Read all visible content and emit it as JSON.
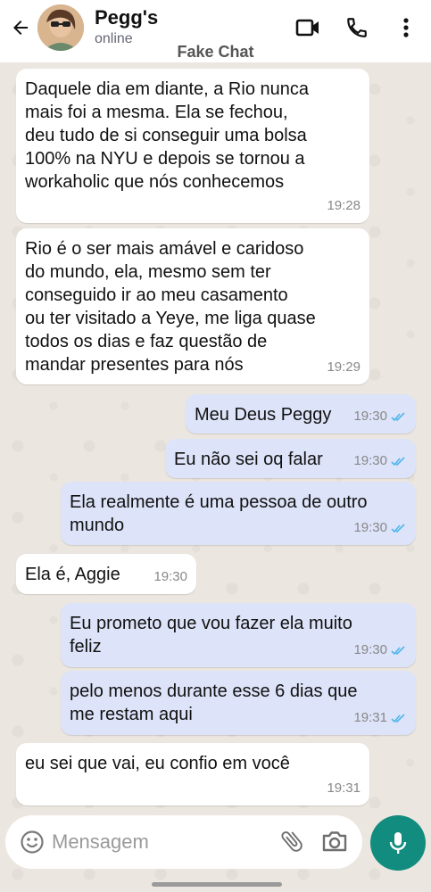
{
  "header": {
    "contact_name": "Pegg's",
    "status": "online",
    "watermark": "Fake Chat",
    "icons": [
      "back-arrow-icon",
      "video-call-icon",
      "phone-icon",
      "more-options-icon"
    ]
  },
  "messages": [
    {
      "direction": "in",
      "text": "Daquele dia em diante, a Rio nunca\nmais foi a mesma. Ela se fechou,\ndeu tudo de si conseguir uma bolsa\n100% na NYU e depois se tornou a\nworkaholic  que nós conhecemos",
      "time": "19:28"
    },
    {
      "direction": "in",
      "text": "Rio é o ser mais amável e caridoso\ndo mundo, ela, mesmo sem ter\nconseguido ir ao meu casamento\nou ter visitado a Yeye, me liga quase\ntodos os dias e faz questão de\nmandar presentes para nós",
      "time": "19:29"
    },
    {
      "direction": "out",
      "text": "Meu Deus Peggy",
      "time": "19:30",
      "read": true
    },
    {
      "direction": "out",
      "text": "Eu não sei oq falar",
      "time": "19:30",
      "read": true
    },
    {
      "direction": "out",
      "text": "Ela realmente é uma pessoa de outro\nmundo",
      "time": "19:30",
      "read": true
    },
    {
      "direction": "in",
      "text": "Ela é, Aggie",
      "time": "19:30"
    },
    {
      "direction": "out",
      "text": "Eu prometo que vou fazer ela muito\nfeliz",
      "time": "19:30",
      "read": true
    },
    {
      "direction": "out",
      "text": "pelo menos durante esse 6 dias que\nme restam aqui",
      "time": "19:31",
      "read": true
    },
    {
      "direction": "in",
      "text": "eu sei que vai, eu confio em você",
      "time": "19:31"
    }
  ],
  "composer": {
    "placeholder": "Mensagem",
    "icons": [
      "emoji-icon",
      "attach-icon",
      "camera-icon",
      "microphone-icon"
    ]
  },
  "colors": {
    "incoming_bubble": "#ffffff",
    "outgoing_bubble": "#dde3f8",
    "read_ticks": "#4fb6ec",
    "mic_button": "#128c7e",
    "wallpaper": "#ebe6df"
  }
}
